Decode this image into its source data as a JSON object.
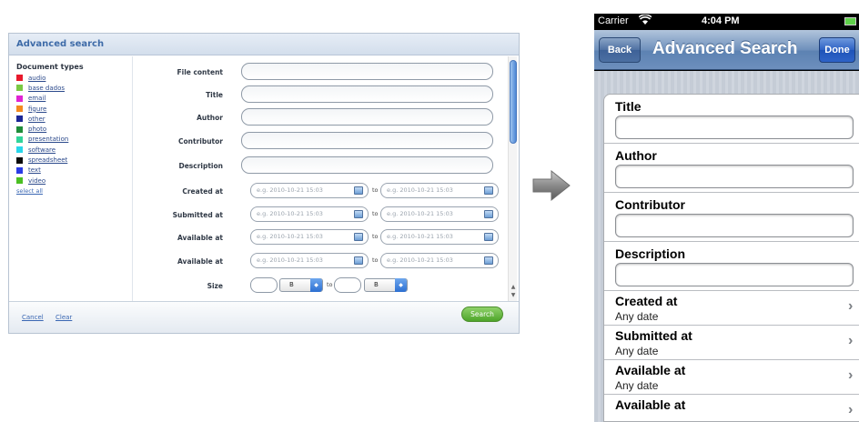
{
  "web": {
    "header_title": "Advanced search",
    "doc_types": {
      "heading": "Document types",
      "items": [
        {
          "label": "audio",
          "color": "#e8192c"
        },
        {
          "label": "base dados",
          "color": "#7ac943"
        },
        {
          "label": "email",
          "color": "#e024d3"
        },
        {
          "label": "figure",
          "color": "#f48a1f"
        },
        {
          "label": "other",
          "color": "#1c2696"
        },
        {
          "label": "photo",
          "color": "#1f8c3a"
        },
        {
          "label": "presentation",
          "color": "#32d49b"
        },
        {
          "label": "software",
          "color": "#28d7ea"
        },
        {
          "label": "spreadsheet",
          "color": "#0b0b0b"
        },
        {
          "label": "text",
          "color": "#2a3ce6"
        },
        {
          "label": "video",
          "color": "#4bbf22"
        }
      ],
      "select_all": "select all"
    },
    "fields": {
      "file_content": "File content",
      "title": "Title",
      "author": "Author",
      "contributor": "Contributor",
      "description": "Description",
      "created_at": "Created at",
      "submitted_at": "Submitted at",
      "available_at_1": "Available at",
      "available_at_2": "Available at",
      "size": "Size"
    },
    "date_placeholder": "e.g. 2010-10-21 15:03",
    "to_label": "to",
    "size_unit": "B",
    "footer": {
      "cancel": "Cancel",
      "clear": "Clear",
      "search": "Search"
    },
    "accent_color": "#3e6ba8",
    "search_button_color": "#4ea52a"
  },
  "phone": {
    "status": {
      "carrier": "Carrier",
      "time": "4:04 PM"
    },
    "navbar": {
      "back": "Back",
      "title": "Advanced Search",
      "done": "Done"
    },
    "text_fields": [
      "Title",
      "Author",
      "Contributor",
      "Description"
    ],
    "date_rows": [
      {
        "label": "Created at",
        "value": "Any date"
      },
      {
        "label": "Submitted at",
        "value": "Any date"
      },
      {
        "label": "Available at",
        "value": "Any date"
      },
      {
        "label": "Available at",
        "value": ""
      }
    ],
    "navbar_color": "#6d8fbb",
    "done_color": "#2d61c4"
  }
}
